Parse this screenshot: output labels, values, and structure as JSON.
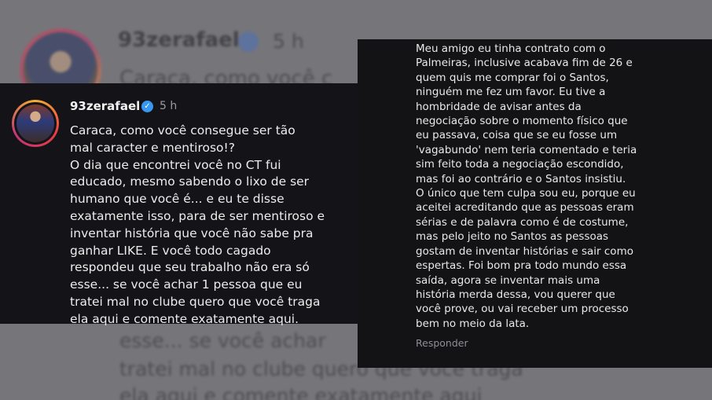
{
  "background": {
    "username": "93zerafael",
    "time": "5 h",
    "top_line": "Caraca, como você c",
    "bottom_lines": [
      "esse... se você achar",
      "tratei mal no clube quero que voce traga",
      "ela aqui e comente exatamente aqui"
    ]
  },
  "left_comment": {
    "username": "93zerafael",
    "time": "5 h",
    "text": "Caraca, como você consegue ser tão\nmal caracter e mentiroso!?\nO dia que encontrei você no CT fui\neducado, mesmo sabendo o lixo de ser\nhumano que você é... e eu te disse\nexatamente isso, para de ser mentiroso e\ninventar história que você não sabe pra\nganhar LIKE. E você todo cagado\nrespondeu que seu trabalho não era só\nesse... se você achar 1 pessoa que eu\ntratei mal no clube quero que você traga\nela aqui e comente exatamente aqui."
  },
  "right_comment": {
    "text": "Meu amigo eu tinha contrato com o\nPalmeiras, inclusive acabava fim de 26 e\nquem quis me comprar foi o Santos,\nninguém me fez um favor. Eu tive a\nhombridade de avisar antes da\nnegociação sobre o momento físico que\neu passava, coisa que se eu fosse um\n'vagabundo' nem teria comentado e teria\nsim feito toda a negociação escondido,\nmas foi ao contrário e o Santos insistiu.\nO único que tem culpa sou eu, porque eu\naceitei acreditando que as pessoas eram\nsérias e de palavra como é de costume,\nmas pelo jeito no Santos as pessoas\ngostam de inventar histórias e sair como\nespertas. Foi bom pra todo mundo essa\nsaída, agora se inventar mais uma\nhistória merda dessa, vou querer que\nvocê prove, ou vai receber um processo\nbem no meio da lata.",
    "reply_label": "Responder"
  },
  "colors": {
    "card_bg": "#141418",
    "verified": "#3897f0",
    "text": "#ececec",
    "muted": "#9a9aa0"
  },
  "icons": {
    "verified": "verified-badge-icon"
  }
}
